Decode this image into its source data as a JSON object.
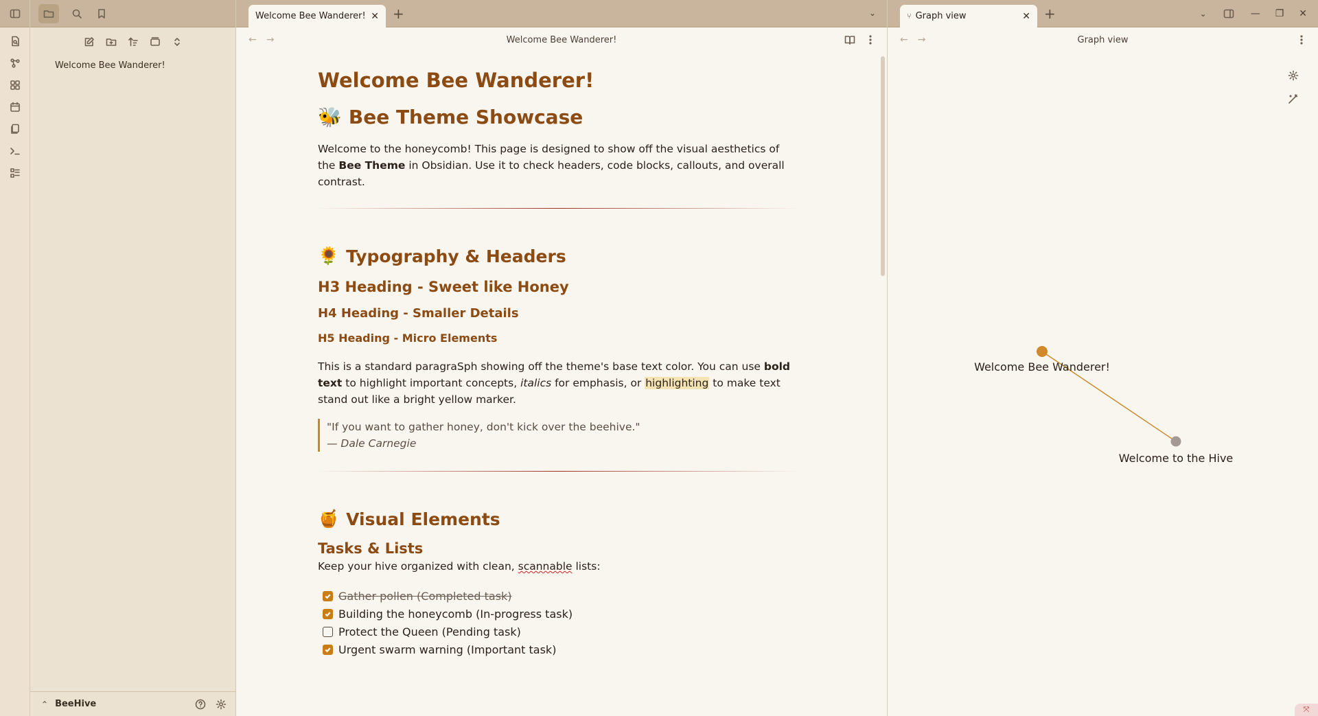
{
  "sidebar": {
    "files": [
      "Welcome Bee Wanderer!"
    ],
    "vault_name": "BeeHive"
  },
  "main": {
    "tab_title": "Welcome Bee Wanderer!",
    "view_title": "Welcome Bee Wanderer!",
    "doc": {
      "h1": "Welcome Bee Wanderer!",
      "h2_showcase": {
        "emoji": "🐝",
        "text": "Bee Theme Showcase"
      },
      "intro": {
        "before": "Welcome to the honeycomb! This page is designed to show off the visual aesthetics of the ",
        "bold": "Bee Theme",
        "after": " in Obsidian. Use it to check headers, code blocks, callouts, and overall contrast."
      },
      "h2_typography": {
        "emoji": "🌻",
        "text": "Typography & Headers"
      },
      "h3": "H3 Heading - Sweet like Honey",
      "h4": "H4 Heading - Smaller Details",
      "h5": "H5 Heading - Micro Elements",
      "para": {
        "t1": "This is a standard paragraSph showing off the theme's base text color. You can use ",
        "bold": "bold text",
        "t2": " to highlight important concepts, ",
        "italic": "italics",
        "t3": " for emphasis, or ",
        "highlight": "highlighting",
        "t4": " to make text stand out like a bright yellow marker."
      },
      "quote": {
        "text": "\"If you want to gather honey, don't kick over the beehive.\"",
        "cite": "— Dale Carnegie"
      },
      "h2_visual": {
        "emoji": "🍯",
        "text": "Visual Elements"
      },
      "h3_tasks": "Tasks & Lists",
      "tasks_intro": {
        "before": "Keep your hive organized with clean, ",
        "spell": "scannable",
        "after": " lists:"
      },
      "tasks": [
        {
          "text": "Gather pollen (Completed task)",
          "checked": true,
          "struck": true
        },
        {
          "text": "Building the honeycomb (In-progress task)",
          "checked": true,
          "struck": false
        },
        {
          "text": "Protect the Queen (Pending task)",
          "checked": false,
          "struck": false
        },
        {
          "text": "Urgent swarm warning (Important task)",
          "checked": true,
          "struck": false
        }
      ]
    }
  },
  "graph": {
    "tab_title": "Graph view",
    "view_title": "Graph view",
    "nodes": [
      {
        "label": "Welcome Bee Wanderer!",
        "color": "#d1892b"
      },
      {
        "label": "Welcome to the Hive",
        "color": "#a39b93"
      }
    ],
    "edge_color": "#c9892b"
  },
  "theme": {
    "accent": "#8b4b12",
    "checkbox": "#c97e14",
    "titlebar": "#c9b59d"
  }
}
